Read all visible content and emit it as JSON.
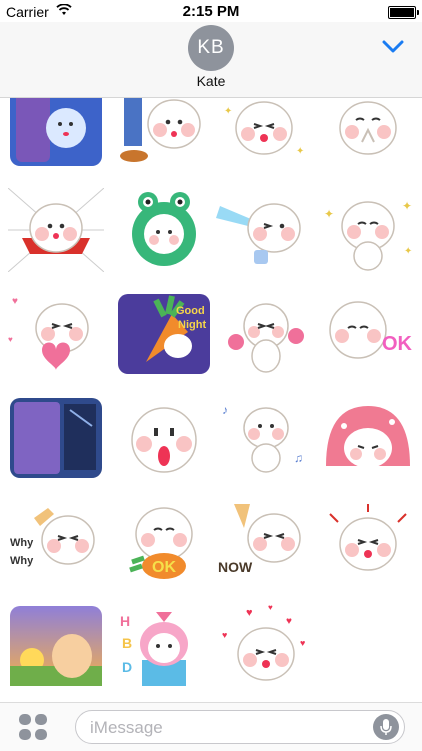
{
  "status_bar": {
    "carrier": "Carrier",
    "time": "2:15 PM"
  },
  "header": {
    "initials": "KB",
    "name": "Kate"
  },
  "stickers": {
    "text_ok_1": "OK",
    "text_ok_2": "OK",
    "text_why_1": "Why",
    "text_why_2": "Why",
    "text_now": "NOW",
    "text_good": "Good",
    "text_night": "Night",
    "text_hbd": [
      "H",
      "B",
      "D"
    ]
  },
  "input_bar": {
    "placeholder": "iMessage"
  },
  "colors": {
    "accent": "#1a7cf2",
    "avatar_bg": "#8e939c",
    "bunny_cheek": "#f9c4c4",
    "ok_pink": "#f25fc0"
  }
}
